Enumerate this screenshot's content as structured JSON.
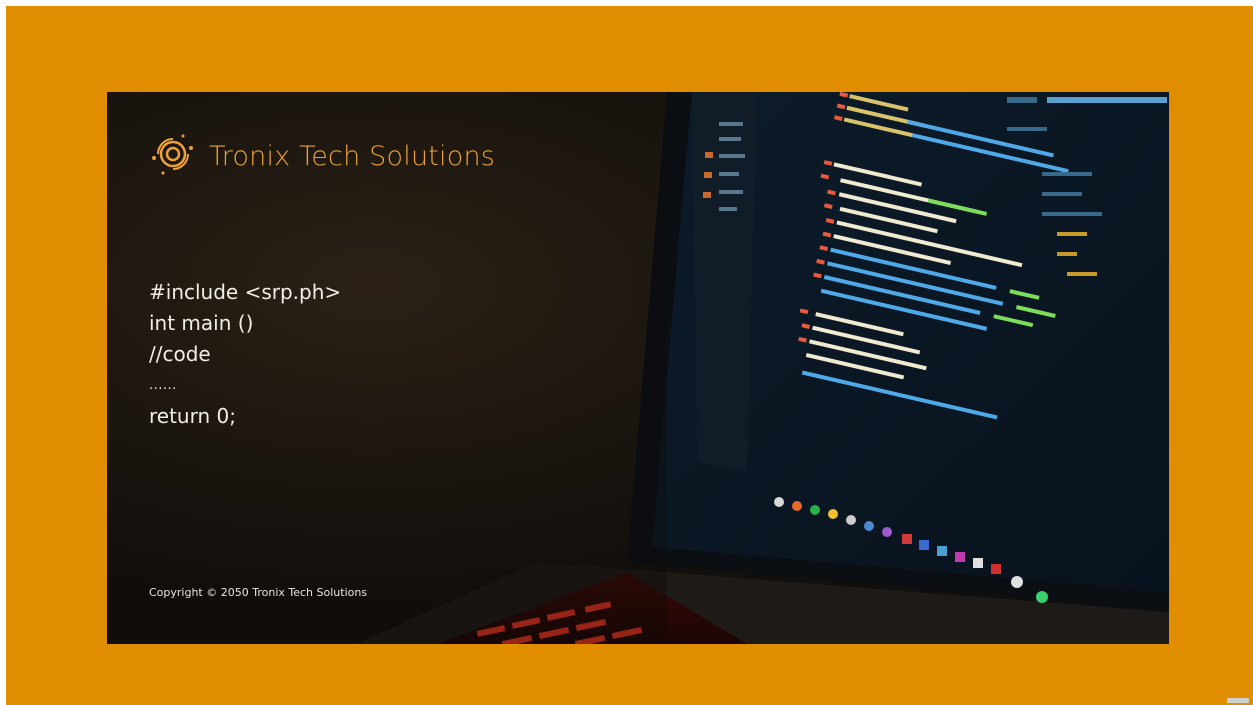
{
  "brand": {
    "name": "Tronix Tech Solutions",
    "icon": "orbit-logo-icon",
    "color": "#eda23a"
  },
  "code_lines": [
    "#include <srp.ph>",
    "int main ()",
    "//code",
    "......",
    "return 0;"
  ],
  "copyright": "Copyright © 2050 Tronix Tech Solutions",
  "colors": {
    "frame": "#e08e00",
    "slide_bg": "#16130f",
    "accent": "#eda23a"
  }
}
